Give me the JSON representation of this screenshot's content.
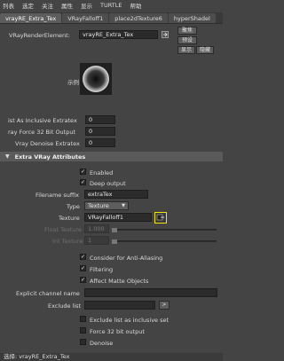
{
  "menu": [
    "列表",
    "选定",
    "关注",
    "属性",
    "显示",
    "TURTLE",
    "帮助"
  ],
  "tabs": [
    "vrayRE_Extra_Tex",
    "VRayFalloff1",
    "place2dTexture6",
    "hyperShadel"
  ],
  "top": {
    "render_element_label": "VRayRenderElement:",
    "render_element_value": "vrayRE_Extra_Tex",
    "focus_btn": "聚焦",
    "preset_btn": "预设",
    "show_btn": "显示",
    "hide_btn": "隐藏",
    "sample_label": "示例"
  },
  "attrs": {
    "list_inclusive_label": "ist As Inclusive Extratex",
    "list_inclusive_value": "0",
    "force32_label": "ray Force 32 Bit Output",
    "force32_value": "0",
    "denoise_label": "Vray Denoise Extratex",
    "denoise_value": "0"
  },
  "section_title": "Extra VRay Attributes",
  "extra": {
    "enabled": "Enabled",
    "deep_output": "Deep output",
    "filename_suffix_label": "Filename suffix",
    "filename_suffix_value": "extraTex",
    "type_label": "Type",
    "type_value": "Texture",
    "texture_label": "Texture",
    "texture_value": "VRayFalloff1",
    "float_texture_label": "Float Texture",
    "float_texture_value": "1.000",
    "int_texture_label": "Int Texture",
    "int_texture_value": "1",
    "consider_aa": "Consider for Anti-Aliasing",
    "filtering": "Filtering",
    "affect_matte": "Affect Matte Objects",
    "explicit_channel_label": "Explicit channel name",
    "exclude_list_label": "Exclude list",
    "exclude_btn": ">",
    "exclude_inclusive": "Exclude list as inclusive set",
    "force32": "Force 32 bit output",
    "denoise": "Denoise"
  },
  "status": "选择: vrayRE_Extra_Tex",
  "check_mark": "✓",
  "colors": {
    "highlight": "#f2e600",
    "background": "#444444"
  }
}
